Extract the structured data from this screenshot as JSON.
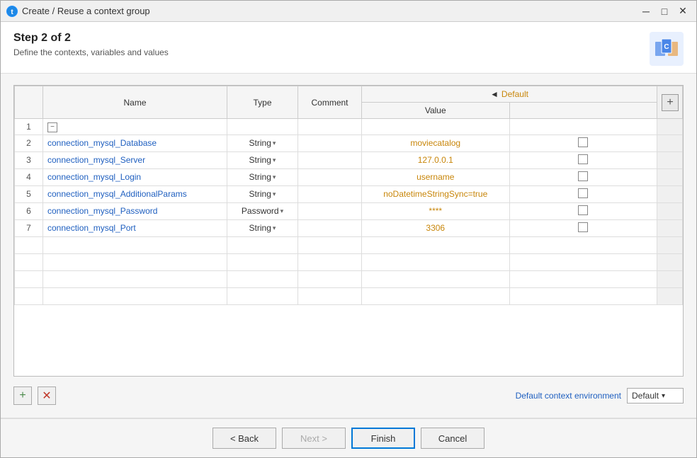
{
  "titleBar": {
    "title": "Create / Reuse a context group",
    "icon": "t",
    "minimizeLabel": "─",
    "maximizeLabel": "□",
    "closeLabel": "✕"
  },
  "header": {
    "step": "Step 2 of 2",
    "description": "Define the contexts, variables and values"
  },
  "table": {
    "columns": {
      "number": "#",
      "name": "Name",
      "type": "Type",
      "comment": "Comment",
      "default": "Default",
      "value": "Value"
    },
    "rows": [
      {
        "num": "1",
        "name": "",
        "type": "",
        "comment": "",
        "value": "",
        "hasCollapse": true,
        "isBlank": false
      },
      {
        "num": "2",
        "name": "connection_mysql_Database",
        "type": "String",
        "comment": "",
        "value": "moviecatalog",
        "hasCollapse": false,
        "isBlank": false
      },
      {
        "num": "3",
        "name": "connection_mysql_Server",
        "type": "String",
        "comment": "",
        "value": "127.0.0.1",
        "hasCollapse": false,
        "isBlank": false
      },
      {
        "num": "4",
        "name": "connection_mysql_Login",
        "type": "String",
        "comment": "",
        "value": "username",
        "hasCollapse": false,
        "isBlank": false
      },
      {
        "num": "5",
        "name": "connection_mysql_AdditionalParams",
        "type": "String",
        "comment": "",
        "value": "noDatetimeStringSync=true",
        "hasCollapse": false,
        "isBlank": false
      },
      {
        "num": "6",
        "name": "connection_mysql_Password",
        "type": "Password",
        "comment": "",
        "value": "****",
        "hasCollapse": false,
        "isBlank": false
      },
      {
        "num": "7",
        "name": "connection_mysql_Port",
        "type": "String",
        "comment": "",
        "value": "3306",
        "hasCollapse": false,
        "isBlank": false
      }
    ]
  },
  "bottomBar": {
    "addLabel": "+",
    "removeLabel": "✕",
    "defaultEnvLabel": "Default context environment",
    "envOptions": [
      "Default"
    ],
    "selectedEnv": "Default"
  },
  "footer": {
    "backLabel": "< Back",
    "nextLabel": "Next >",
    "finishLabel": "Finish",
    "cancelLabel": "Cancel"
  }
}
